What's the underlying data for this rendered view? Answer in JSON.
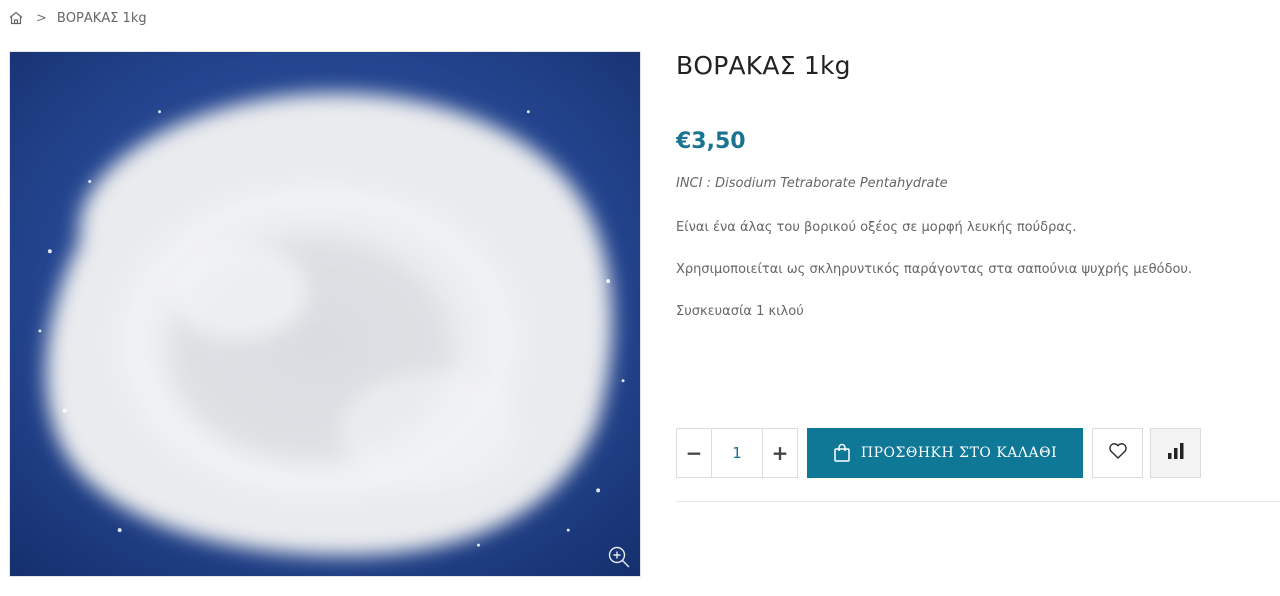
{
  "breadcrumb": {
    "home_icon": "home-icon",
    "separator": ">",
    "current": "ΒΟΡΑΚΑΣ 1kg"
  },
  "product": {
    "title": "ΒΟΡΑΚΑΣ 1kg",
    "price": "€3,50",
    "inci": "INCI : Disodium Tetraborate Pentahydrate",
    "description": [
      "Είναι ένα άλας του βορικού οξέος σε μορφή λευκής πούδρας.",
      "Χρησιμοποιείται ως σκληρυντικός παράγοντας στα σαπούνια ψυχρής μεθόδου.",
      "Συσκευασία 1 κιλού"
    ],
    "image_icon": "zoom-in-icon"
  },
  "actions": {
    "quantity": "1",
    "minus_label": "−",
    "plus_label": "+",
    "add_to_cart": "ΠΡΟΣΘΗΚΗ ΣΤΟ ΚΑΛΑΘΙ",
    "cart_icon": "shopping-bag-icon",
    "wishlist_icon": "heart-icon",
    "compare_icon": "bar-chart-icon"
  },
  "colors": {
    "accent": "#0f7896",
    "price": "#1a7391",
    "photo_background": "#1f3f86",
    "powder": "#eef0f2"
  }
}
